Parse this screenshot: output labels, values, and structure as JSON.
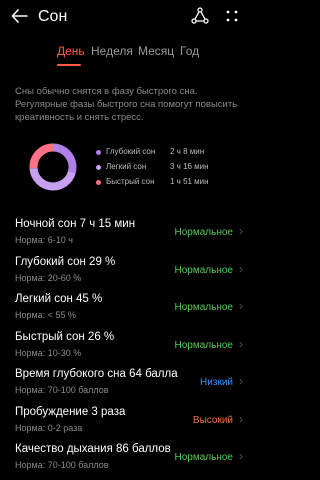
{
  "header": {
    "title": "Сон"
  },
  "tabs": [
    {
      "label": "День",
      "active": true
    },
    {
      "label": "Неделя",
      "active": false
    },
    {
      "label": "Месяц",
      "active": false
    },
    {
      "label": "Год",
      "active": false
    }
  ],
  "info_text": "Сны обычно снятся в фазу быстрого сна. Регулярные фазы быстрого сна помогут повысить креативность и снять стресс.",
  "chart_data": {
    "type": "pie",
    "categories": [
      "Глубокий сон",
      "Легкий сон",
      "Быстрый сон"
    ],
    "values": [
      29,
      45,
      26
    ],
    "value_labels": [
      "2 ч 8 мин",
      "3 ч 16 мин",
      "1 ч 51 мин"
    ],
    "colors": [
      "#b07fe8",
      "#c7a0f2",
      "#ff7189"
    ]
  },
  "metrics": [
    {
      "title": "Ночной сон  7 ч 15 мин",
      "norm": "Норма: 6-10 ч",
      "status": "Нормальное",
      "status_color": "#57c957"
    },
    {
      "title": "Глубокий сон  29 %",
      "norm": "Норма: 20-60 %",
      "status": "Нормальное",
      "status_color": "#57c957"
    },
    {
      "title": "Легкий сон  45 %",
      "norm": "Норма: < 55 %",
      "status": "Нормальное",
      "status_color": "#57c957"
    },
    {
      "title": "Быстрый сон  26 %",
      "norm": "Норма: 10-30 %",
      "status": "Нормальное",
      "status_color": "#57c957"
    },
    {
      "title": "Время глубокого сна  64 балла",
      "norm": "Норма: 70-100 баллов",
      "status": "Низкий",
      "status_color": "#3d8cf5"
    },
    {
      "title": "Пробуждение  3 раза",
      "norm": "Норма: 0-2 раза",
      "status": "Высокий",
      "status_color": "#f26a4a"
    },
    {
      "title": "Качество дыхания  86 баллов",
      "norm": "Норма: 70-100 баллов",
      "status": "Нормальное",
      "status_color": "#57c957"
    }
  ],
  "icons": {
    "back": "arrow-left-icon",
    "share": "share-icon",
    "more": "more-dots-icon",
    "chevron": "chevron-right-icon"
  }
}
